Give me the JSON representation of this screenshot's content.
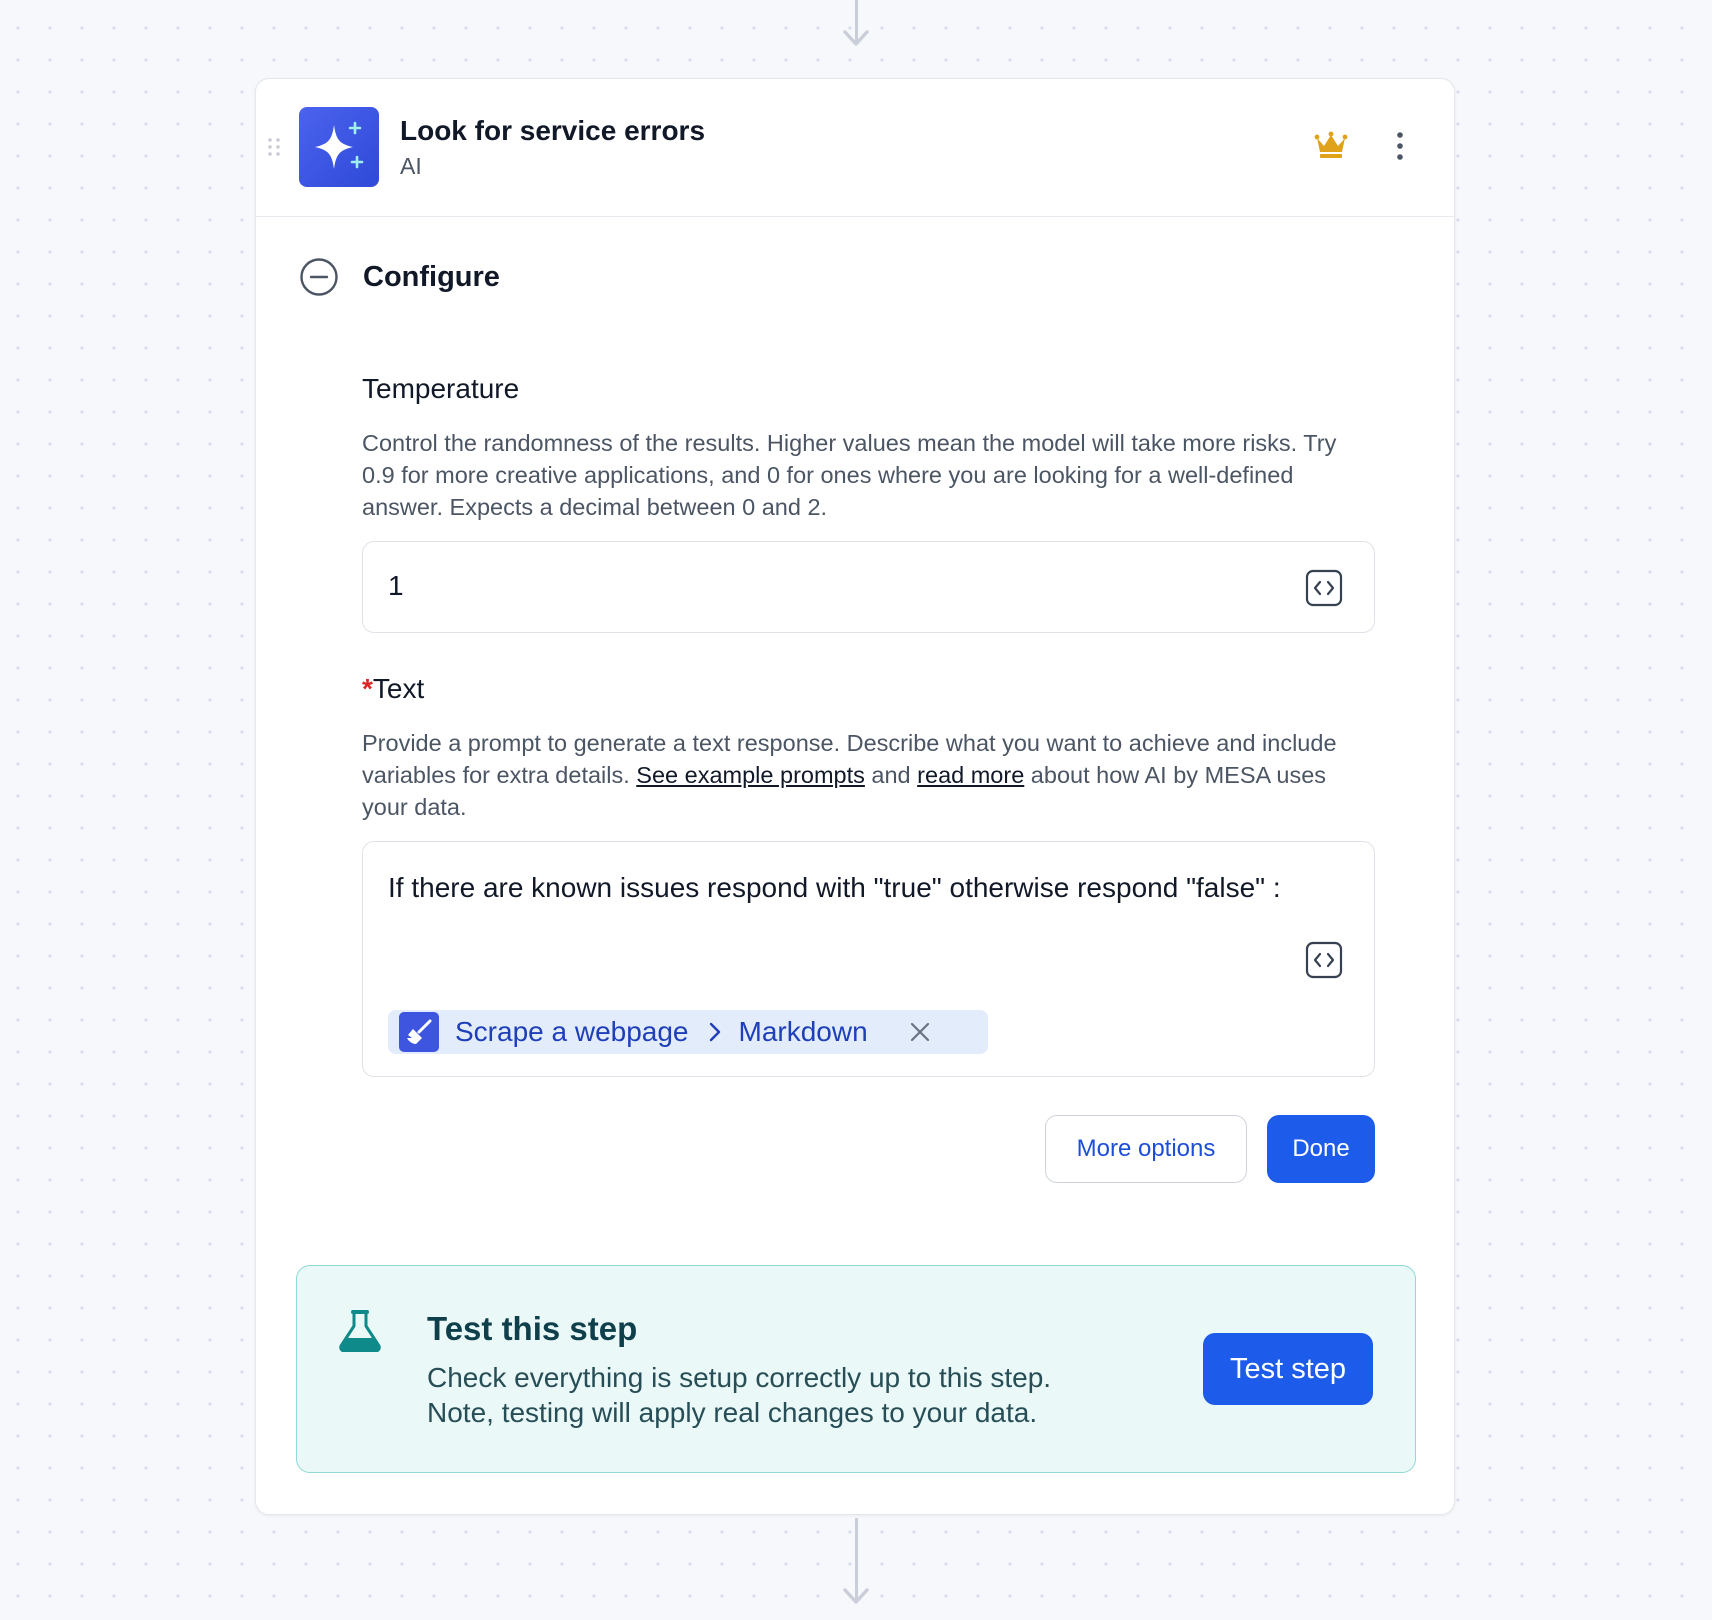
{
  "step": {
    "title": "Look for service errors",
    "subtitle": "AI"
  },
  "configure": {
    "section_title": "Configure"
  },
  "temperature": {
    "label": "Temperature",
    "help": "Control the randomness of the results. Higher values mean the model will take more risks. Try 0.9 for more creative applications, and 0 for ones where you are looking for a well-defined answer. Expects a decimal between 0 and 2.",
    "value": "1"
  },
  "text_field": {
    "required_mark": "*",
    "label": "Text",
    "help_before": "Provide a prompt to generate a text response. Describe what you want to achieve and include variables for extra details. ",
    "link_examples": "See example prompts",
    "help_middle": " and ",
    "link_read_more": "read more",
    "help_after": " about how AI by MESA uses your data.",
    "value": "If there are known issues respond with \"true\" otherwise respond \"false\" :",
    "variable": {
      "source": "Scrape a webpage",
      "field": "Markdown"
    }
  },
  "buttons": {
    "more_options": "More options",
    "done": "Done"
  },
  "test_panel": {
    "title": "Test this step",
    "description_line1": "Check everything is setup correctly up to this step.",
    "description_line2": "Note, testing will apply real changes to your data.",
    "button": "Test step"
  },
  "colors": {
    "primary": "#1d5bea",
    "app_icon": "#3e56df",
    "crown": "#e0a21b",
    "required": "#dc2626",
    "chip_bg": "#e2ecfb",
    "test_bg": "#eaf8f8",
    "test_border": "#8fdad7"
  },
  "icons": {
    "app": "sparkles-icon",
    "premium": "crown-icon",
    "menu": "kebab-menu-icon",
    "collapse": "minus-circle-icon",
    "code": "code-brackets-icon",
    "variable_source": "broom-icon",
    "close": "close-icon",
    "test": "flask-icon"
  }
}
